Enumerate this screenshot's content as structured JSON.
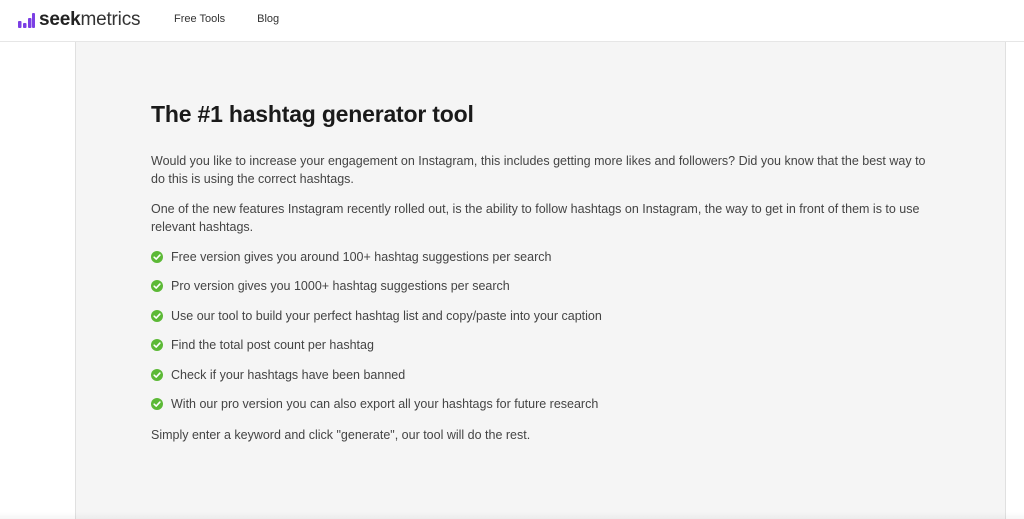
{
  "header": {
    "logo_bold": "seek",
    "logo_light": "metrics",
    "logo_icon": "bar-chart-icon",
    "nav": [
      {
        "label": "Free Tools"
      },
      {
        "label": "Blog"
      }
    ]
  },
  "main": {
    "title": "The #1 hashtag generator tool",
    "intro_1": "Would you like to increase your engagement on Instagram, this includes getting more likes and followers? Did you know that the best way to do this is using the correct hashtags.",
    "intro_2": "One of the new features Instagram recently rolled out, is the ability to follow hashtags on Instagram, the way to get in front of them is to use relevant hashtags.",
    "features": [
      {
        "text": "Free version gives you around 100+ hashtag suggestions per search"
      },
      {
        "text": "Pro version gives you 1000+ hashtag suggestions per search"
      },
      {
        "text": "Use our tool to build your perfect hashtag list and copy/paste into your caption"
      },
      {
        "text": "Find the total post count per hashtag"
      },
      {
        "text": "Check if your hashtags have been banned"
      },
      {
        "text": "With our pro version you can also export all your hashtags for future research"
      }
    ],
    "outro": "Simply enter a keyword and click \"generate\", our tool will do the rest."
  },
  "colors": {
    "brand_purple": "#7b3fe4",
    "check_green": "#5cb936",
    "panel_bg": "#f5f5f5"
  }
}
